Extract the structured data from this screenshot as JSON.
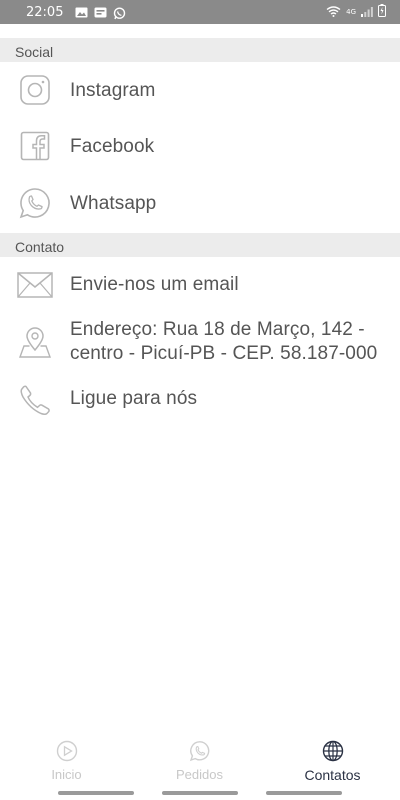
{
  "status_bar": {
    "time": "22:05",
    "network": "4G",
    "notification_icons": [
      "image-icon",
      "app-notification-icon",
      "whatsapp-icon"
    ],
    "system_icons": [
      "wifi-icon",
      "signal-icon",
      "battery-icon"
    ]
  },
  "sections": {
    "social": {
      "title": "Social",
      "items": [
        {
          "label": "Instagram",
          "icon": "instagram-icon"
        },
        {
          "label": "Facebook",
          "icon": "facebook-icon"
        },
        {
          "label": "Whatsapp",
          "icon": "whatsapp-icon"
        }
      ]
    },
    "contato": {
      "title": "Contato",
      "items": [
        {
          "label": "Envie-nos um email",
          "icon": "mail-icon"
        },
        {
          "label": "Endereço: Rua 18 de Março, 142 - centro - Picuí-PB - CEP. 58.187-000",
          "icon": "map-pin-icon"
        },
        {
          "label": "Ligue para nós",
          "icon": "phone-icon"
        }
      ]
    }
  },
  "bottom_nav": {
    "items": [
      {
        "label": "Inicio",
        "icon": "play-circle-icon",
        "active": false
      },
      {
        "label": "Pedidos",
        "icon": "whatsapp-icon",
        "active": false
      },
      {
        "label": "Contatos",
        "icon": "globe-icon",
        "active": true
      }
    ]
  },
  "colors": {
    "status_bar": "#8a8a8a",
    "section_header": "#ececec",
    "text": "#555555",
    "icon": "#b5b5b5",
    "nav_active": "#2b3244",
    "nav_inactive": "#c8c8c8"
  }
}
